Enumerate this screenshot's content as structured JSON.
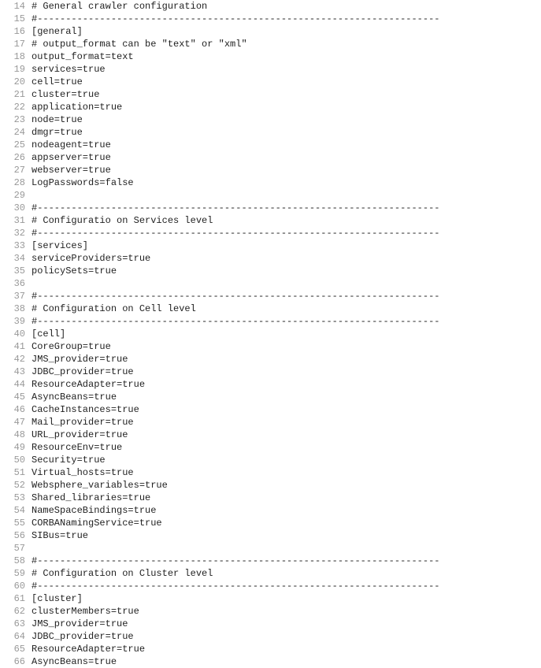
{
  "lines": [
    {
      "n": 14,
      "t": "# General crawler configuration"
    },
    {
      "n": 15,
      "t": "#-----------------------------------------------------------------------"
    },
    {
      "n": 16,
      "t": "[general]"
    },
    {
      "n": 17,
      "t": "# output_format can be \"text\" or \"xml\""
    },
    {
      "n": 18,
      "t": "output_format=text"
    },
    {
      "n": 19,
      "t": "services=true"
    },
    {
      "n": 20,
      "t": "cell=true"
    },
    {
      "n": 21,
      "t": "cluster=true"
    },
    {
      "n": 22,
      "t": "application=true"
    },
    {
      "n": 23,
      "t": "node=true"
    },
    {
      "n": 24,
      "t": "dmgr=true"
    },
    {
      "n": 25,
      "t": "nodeagent=true"
    },
    {
      "n": 26,
      "t": "appserver=true"
    },
    {
      "n": 27,
      "t": "webserver=true"
    },
    {
      "n": 28,
      "t": "LogPasswords=false"
    },
    {
      "n": 29,
      "t": ""
    },
    {
      "n": 30,
      "t": "#-----------------------------------------------------------------------"
    },
    {
      "n": 31,
      "t": "# Configuratio on Services level"
    },
    {
      "n": 32,
      "t": "#-----------------------------------------------------------------------"
    },
    {
      "n": 33,
      "t": "[services]"
    },
    {
      "n": 34,
      "t": "serviceProviders=true"
    },
    {
      "n": 35,
      "t": "policySets=true"
    },
    {
      "n": 36,
      "t": ""
    },
    {
      "n": 37,
      "t": "#-----------------------------------------------------------------------"
    },
    {
      "n": 38,
      "t": "# Configuration on Cell level"
    },
    {
      "n": 39,
      "t": "#-----------------------------------------------------------------------"
    },
    {
      "n": 40,
      "t": "[cell]"
    },
    {
      "n": 41,
      "t": "CoreGroup=true"
    },
    {
      "n": 42,
      "t": "JMS_provider=true"
    },
    {
      "n": 43,
      "t": "JDBC_provider=true"
    },
    {
      "n": 44,
      "t": "ResourceAdapter=true"
    },
    {
      "n": 45,
      "t": "AsyncBeans=true"
    },
    {
      "n": 46,
      "t": "CacheInstances=true"
    },
    {
      "n": 47,
      "t": "Mail_provider=true"
    },
    {
      "n": 48,
      "t": "URL_provider=true"
    },
    {
      "n": 49,
      "t": "ResourceEnv=true"
    },
    {
      "n": 50,
      "t": "Security=true"
    },
    {
      "n": 51,
      "t": "Virtual_hosts=true"
    },
    {
      "n": 52,
      "t": "Websphere_variables=true"
    },
    {
      "n": 53,
      "t": "Shared_libraries=true"
    },
    {
      "n": 54,
      "t": "NameSpaceBindings=true"
    },
    {
      "n": 55,
      "t": "CORBANamingService=true"
    },
    {
      "n": 56,
      "t": "SIBus=true"
    },
    {
      "n": 57,
      "t": ""
    },
    {
      "n": 58,
      "t": "#-----------------------------------------------------------------------"
    },
    {
      "n": 59,
      "t": "# Configuration on Cluster level"
    },
    {
      "n": 60,
      "t": "#-----------------------------------------------------------------------"
    },
    {
      "n": 61,
      "t": "[cluster]"
    },
    {
      "n": 62,
      "t": "clusterMembers=true"
    },
    {
      "n": 63,
      "t": "JMS_provider=true"
    },
    {
      "n": 64,
      "t": "JDBC_provider=true"
    },
    {
      "n": 65,
      "t": "ResourceAdapter=true"
    },
    {
      "n": 66,
      "t": "AsyncBeans=true"
    }
  ]
}
